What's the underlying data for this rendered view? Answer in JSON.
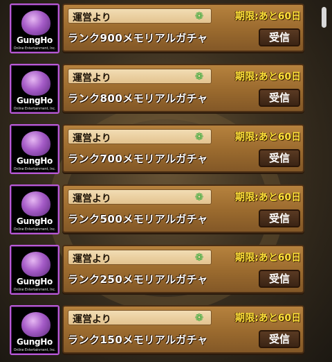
{
  "items": [
    {
      "sender": "運営より",
      "title": "ランク900メモリアルガチャ",
      "deadline": "期限:あと60日",
      "button": "受信",
      "brand": "GungHo",
      "brand_sub": "Online Entertainment, Inc."
    },
    {
      "sender": "運営より",
      "title": "ランク800メモリアルガチャ",
      "deadline": "期限:あと60日",
      "button": "受信",
      "brand": "GungHo",
      "brand_sub": "Online Entertainment, Inc."
    },
    {
      "sender": "運営より",
      "title": "ランク700メモリアルガチャ",
      "deadline": "期限:あと60日",
      "button": "受信",
      "brand": "GungHo",
      "brand_sub": "Online Entertainment, Inc."
    },
    {
      "sender": "運営より",
      "title": "ランク500メモリアルガチャ",
      "deadline": "期限:あと60日",
      "button": "受信",
      "brand": "GungHo",
      "brand_sub": "Online Entertainment, Inc."
    },
    {
      "sender": "運営より",
      "title": "ランク250メモリアルガチャ",
      "deadline": "期限:あと60日",
      "button": "受信",
      "brand": "GungHo",
      "brand_sub": "Online Entertainment, Inc."
    },
    {
      "sender": "運営より",
      "title": "ランク150メモリアルガチャ",
      "deadline": "期限:あと60日",
      "button": "受信",
      "brand": "GungHo",
      "brand_sub": "Online Entertainment, Inc."
    }
  ],
  "icons": {
    "sender_icon": "dragon-icon",
    "avatar_logo": "gungho-logo"
  },
  "colors": {
    "deadline": "#ffe23a",
    "avatar_border": "#b85ad6",
    "panel": "#9a6a2e"
  }
}
